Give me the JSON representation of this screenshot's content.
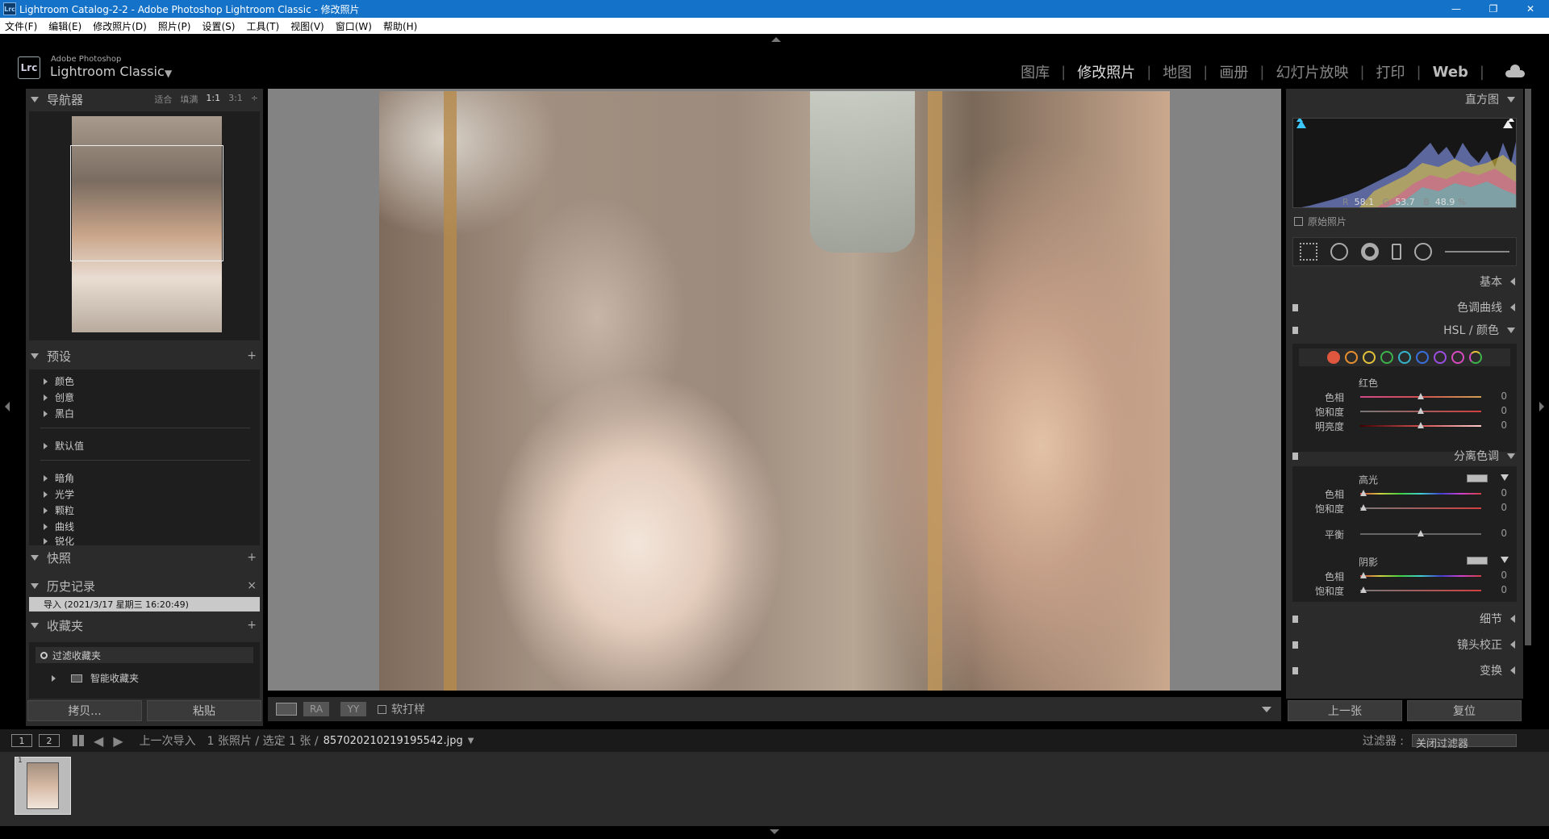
{
  "window": {
    "title": "Lightroom Catalog-2-2 - Adobe Photoshop Lightroom Classic - 修改照片",
    "app_icon": "Lrc",
    "min": "—",
    "max": "❐",
    "close": "✕"
  },
  "menu": [
    "文件(F)",
    "编辑(E)",
    "修改照片(D)",
    "照片(P)",
    "设置(S)",
    "工具(T)",
    "视图(V)",
    "窗口(W)",
    "帮助(H)"
  ],
  "brand": {
    "logo": "Lrc",
    "small": "Adobe Photoshop",
    "big": "Lightroom Classic",
    "caret": "▼"
  },
  "modules": [
    "图库",
    "修改照片",
    "地图",
    "画册",
    "幻灯片放映",
    "打印",
    "Web"
  ],
  "active_module": "修改照片",
  "navigator": {
    "title": "导航器",
    "options": [
      "适合",
      "填满",
      "1:1",
      "3:1"
    ],
    "selected_option": "1:1",
    "spinner": "÷"
  },
  "presets": {
    "title": "预设",
    "plus": "+",
    "groups_a": [
      "颜色",
      "创意",
      "黑白"
    ],
    "groups_b": [
      "默认值"
    ],
    "groups_c": [
      "暗角",
      "光学",
      "颗粒",
      "曲线",
      "锐化"
    ]
  },
  "snapshots": {
    "title": "快照",
    "plus": "+"
  },
  "history": {
    "title": "历史记录",
    "close": "×",
    "items": [
      "导入 (2021/3/17 星期三 16:20:49)"
    ]
  },
  "collections": {
    "title": "收藏夹",
    "plus": "+",
    "filter_placeholder": "过滤收藏夹",
    "smart": "智能收藏夹"
  },
  "left_buttons": {
    "copy": "拷贝...",
    "paste": "粘贴"
  },
  "toolbar": {
    "ra": "RA",
    "yy": "YY",
    "softproof": "软打样"
  },
  "right": {
    "histogram_title": "直方图",
    "rgb": {
      "r_label": "R",
      "r": "58.1",
      "g_label": "G",
      "g": "53.7",
      "b_label": "B",
      "b": "48.9",
      "pct": "%"
    },
    "original_photo": "原始照片",
    "basic": "基本",
    "tone_curve": "色调曲线",
    "hsl": "HSL / 颜色",
    "hsl_color": "红色",
    "hsl_rows": [
      {
        "label": "色相",
        "value": "0"
      },
      {
        "label": "饱和度",
        "value": "0"
      },
      {
        "label": "明亮度",
        "value": "0"
      }
    ],
    "split_toning": "分离色调",
    "highlights": "高光",
    "hl_rows": [
      {
        "label": "色相",
        "value": "0"
      },
      {
        "label": "饱和度",
        "value": "0"
      }
    ],
    "balance": {
      "label": "平衡",
      "value": "0"
    },
    "shadows": "阴影",
    "sh_rows": [
      {
        "label": "色相",
        "value": "0"
      },
      {
        "label": "饱和度",
        "value": "0"
      }
    ],
    "detail": "细节",
    "lens": "镜头校正",
    "transform": "变换",
    "prev_button": "上一张",
    "reset_button": "复位"
  },
  "colors": {
    "dots": [
      "#e0573f",
      "#e8902e",
      "#e3c23a",
      "#3cb34a",
      "#33b6c9",
      "#3b6fe0",
      "#9b4ee0",
      "#d84ac0",
      "#e0563f"
    ]
  },
  "filmstrip": {
    "page1": "1",
    "page2": "2",
    "source": "上一次导入",
    "count": "1 张照片 / 选定 1 张 /",
    "filename": "857020210219195542.jpg",
    "filename_caret": "▼",
    "filter_label": "过滤器 :",
    "filter_value": "关闭过滤器",
    "thumb_number": "1"
  }
}
